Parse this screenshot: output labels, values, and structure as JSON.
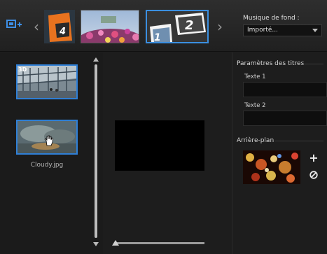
{
  "toolbar": {
    "icons": {
      "add": "add-to-project-icon",
      "prev": "chevron-left-icon",
      "next": "chevron-right-icon"
    },
    "thumbnails": [
      {
        "badge": "4"
      },
      {
        "badge": ""
      },
      {
        "badge_a": "1",
        "badge_b": "2"
      }
    ]
  },
  "music": {
    "label": "Musique de fond :",
    "selected": "Importé..."
  },
  "library": {
    "items": [
      {
        "badge": "3D",
        "label": ""
      },
      {
        "badge": "",
        "label": "Cloudy.jpg"
      }
    ]
  },
  "titles": {
    "section_label": "Paramètres des titres",
    "text1_label": "Texte 1",
    "text1_value": "",
    "text2_label": "Texte 2",
    "text2_value": ""
  },
  "background": {
    "section_label": "Arrière-plan",
    "add_symbol": "+",
    "icons": {
      "add": "plus-icon",
      "remove": "no-entry-icon"
    }
  },
  "colors": {
    "accent": "#2f7fd6",
    "panel": "#1d1d1d"
  }
}
